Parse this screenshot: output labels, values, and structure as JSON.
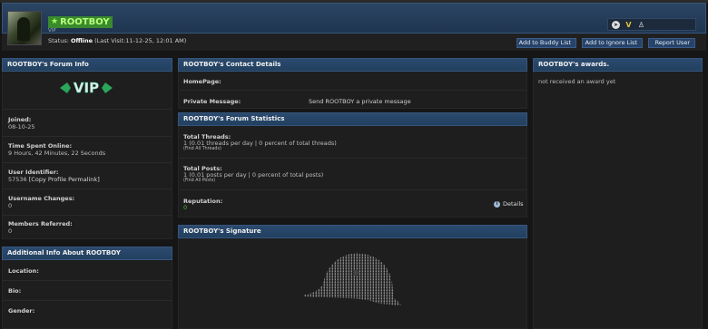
{
  "header": {
    "username": "ROOTBOY",
    "rank": "VIP",
    "status_label": "Status:",
    "status_value": "Offline",
    "last_visit": "(Last Visit:11-12-25, 12:01 AM)",
    "buttons": {
      "buddy": "Add to Buddy List",
      "ignore": "Add to Ignore List",
      "report": "Report User"
    },
    "social_icons": [
      "telegram-icon",
      "vip-v-icon",
      "linux-tux-icon"
    ]
  },
  "forum_info": {
    "title": "ROOTBOY's Forum Info",
    "logo_text": "VIP",
    "joined_label": "Joined:",
    "joined": "08-10-25",
    "time_online_label": "Time Spent Online:",
    "time_online": "9 Hours, 42 Minutes, 22 Seconds",
    "identifier_label": "User Identifier:",
    "identifier": "57536",
    "permalink": "[Copy Profile Permalink]",
    "username_changes_label": "Username Changes:",
    "username_changes": "0",
    "members_referred_label": "Members Referred:",
    "members_referred": "0"
  },
  "additional_info": {
    "title": "Additional Info About ROOTBOY",
    "location_label": "Location:",
    "bio_label": "Bio:",
    "gender_label": "Gender:"
  },
  "contact": {
    "title": "ROOTBOY's Contact Details",
    "homepage_label": "HomePage:",
    "pm_label": "Private Message:",
    "pm_link": "Send ROOTBOY a private message"
  },
  "stats": {
    "title": "ROOTBOY's Forum Statistics",
    "threads_label": "Total Threads:",
    "threads_value": "1 (0.01 threads per day | 0 percent of total threads)",
    "threads_link": "(Find All Threads)",
    "posts_label": "Total Posts:",
    "posts_value": "1 (0.01 posts per day | 0 percent of total posts)",
    "posts_link": "(Find All Posts)",
    "reputation_label": "Reputation:",
    "reputation_value": "0",
    "details_link": "Details"
  },
  "signature": {
    "title": "ROOTBOY's Signature"
  },
  "awards": {
    "title": "ROOTBOY's awards.",
    "text": "not received an award yet"
  },
  "colors": {
    "header_blue": "#274369",
    "username_bg": "#3a8a2e",
    "username_text": "#b8ff7a",
    "background": "#161616"
  }
}
